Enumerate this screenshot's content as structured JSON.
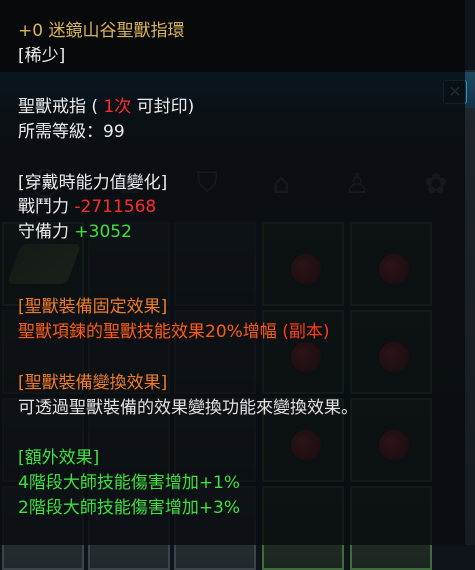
{
  "item": {
    "name": "+0 迷鏡山谷聖獸指環",
    "rarity": "[稀少]"
  },
  "info": {
    "type_prefix": "聖獸戒指 ( ",
    "seal_count": "1次",
    "type_suffix": " 可封印)",
    "level_req": "所需等級：99"
  },
  "stats": {
    "header": "[穿戴時能力值變化]",
    "power_label": "戰鬥力 ",
    "power_value": "-2711568",
    "defense_label": "守備力 ",
    "defense_value": "+3052"
  },
  "fixed_effect": {
    "header": "[聖獸裝備固定效果]",
    "text": "聖獸項鍊的聖獸技能效果20%增幅 ",
    "tag": "(副本)"
  },
  "convert_effect": {
    "header": "[聖獸裝備變換效果]",
    "text": "可透過聖獸裝備的效果變換功能來變換效果。"
  },
  "extra_effect": {
    "header": "[額外效果]",
    "line1": "4階段大師技能傷害增加+1%",
    "line2": "2階段大師技能傷害增加+3%"
  },
  "colors": {
    "title": "#d9b35a",
    "negative": "#ff2b2b",
    "positive": "#3fe03f",
    "effect_header": "#f07a28"
  },
  "background_icons": [
    "helmet-icon",
    "armor-icon",
    "shield-icon",
    "house-icon",
    "shirt-icon",
    "beast-icon"
  ]
}
